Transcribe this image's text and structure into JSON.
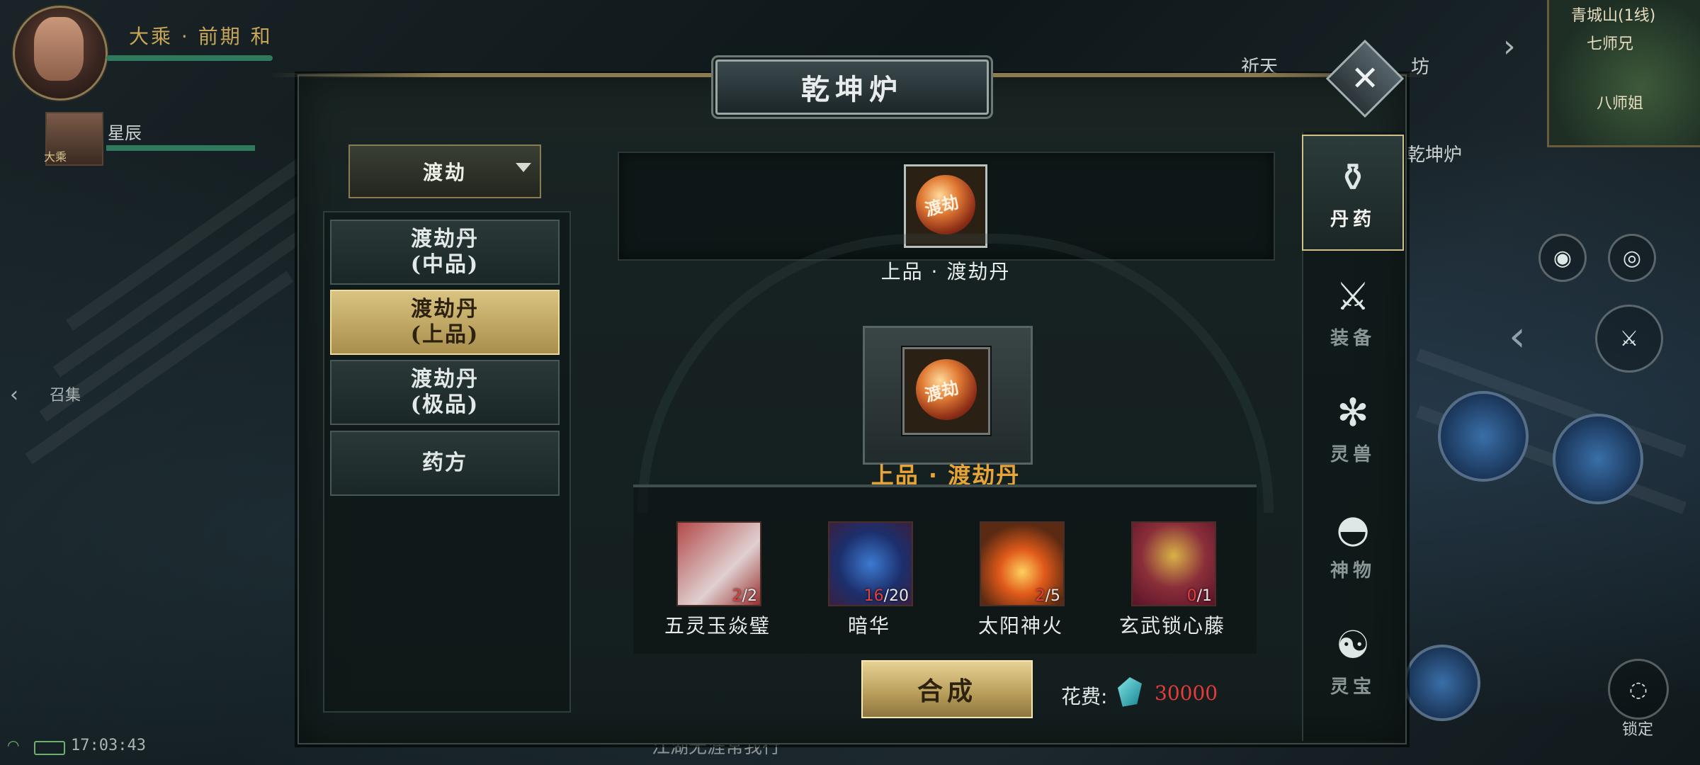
{
  "hud": {
    "player_name": "大乘 · 前期  和",
    "party_member": "星辰",
    "party_tag": "大乘",
    "summon_label": "召集",
    "clock": "17:03:43",
    "top_labels": [
      "祈天",
      "坊",
      "乾坤炉"
    ],
    "map_title": "青城山(1线)",
    "map_sub": "七师兄",
    "map_sub2": "八师姐",
    "lock_label": "锁定",
    "bottom_text": "江湖无涯常我行"
  },
  "panel": {
    "title": "乾坤炉",
    "close_icon": "close-icon",
    "category": {
      "selected": "渡劫"
    },
    "recipes": [
      {
        "line1": "渡劫丹",
        "line2": "(中品)",
        "active": false
      },
      {
        "line1": "渡劫丹",
        "line2": "(上品)",
        "active": true
      },
      {
        "line1": "渡劫丹",
        "line2": "(极品)",
        "active": false
      },
      {
        "line1": "药方",
        "line2": "",
        "active": false
      }
    ],
    "preview_item": {
      "name": "上品 · 渡劫丹",
      "glyph": "渡劫"
    },
    "result_item": {
      "name": "上品 · 渡劫丹",
      "glyph": "渡劫"
    },
    "materials": [
      {
        "name": "五灵玉焱璧",
        "have": "2",
        "need": "2",
        "color": "#c04848"
      },
      {
        "name": "暗华",
        "have": "16",
        "need": "20",
        "color": "#3b4f8c"
      },
      {
        "name": "太阳神火",
        "have": "2",
        "need": "5",
        "color": "#5a2a12"
      },
      {
        "name": "玄武锁心藤",
        "have": "0",
        "need": "1",
        "color": "#7a1c3a"
      }
    ],
    "synth_button": "合成",
    "cost_label": "花费:",
    "cost_value": "30000"
  },
  "tabs": [
    {
      "label": "丹药",
      "icon": "mortar-icon",
      "active": true
    },
    {
      "label": "装备",
      "icon": "sword-icon",
      "active": false
    },
    {
      "label": "灵兽",
      "icon": "paw-icon",
      "active": false
    },
    {
      "label": "神物",
      "icon": "fan-icon",
      "active": false
    },
    {
      "label": "灵宝",
      "icon": "treasure-icon",
      "active": false
    }
  ]
}
